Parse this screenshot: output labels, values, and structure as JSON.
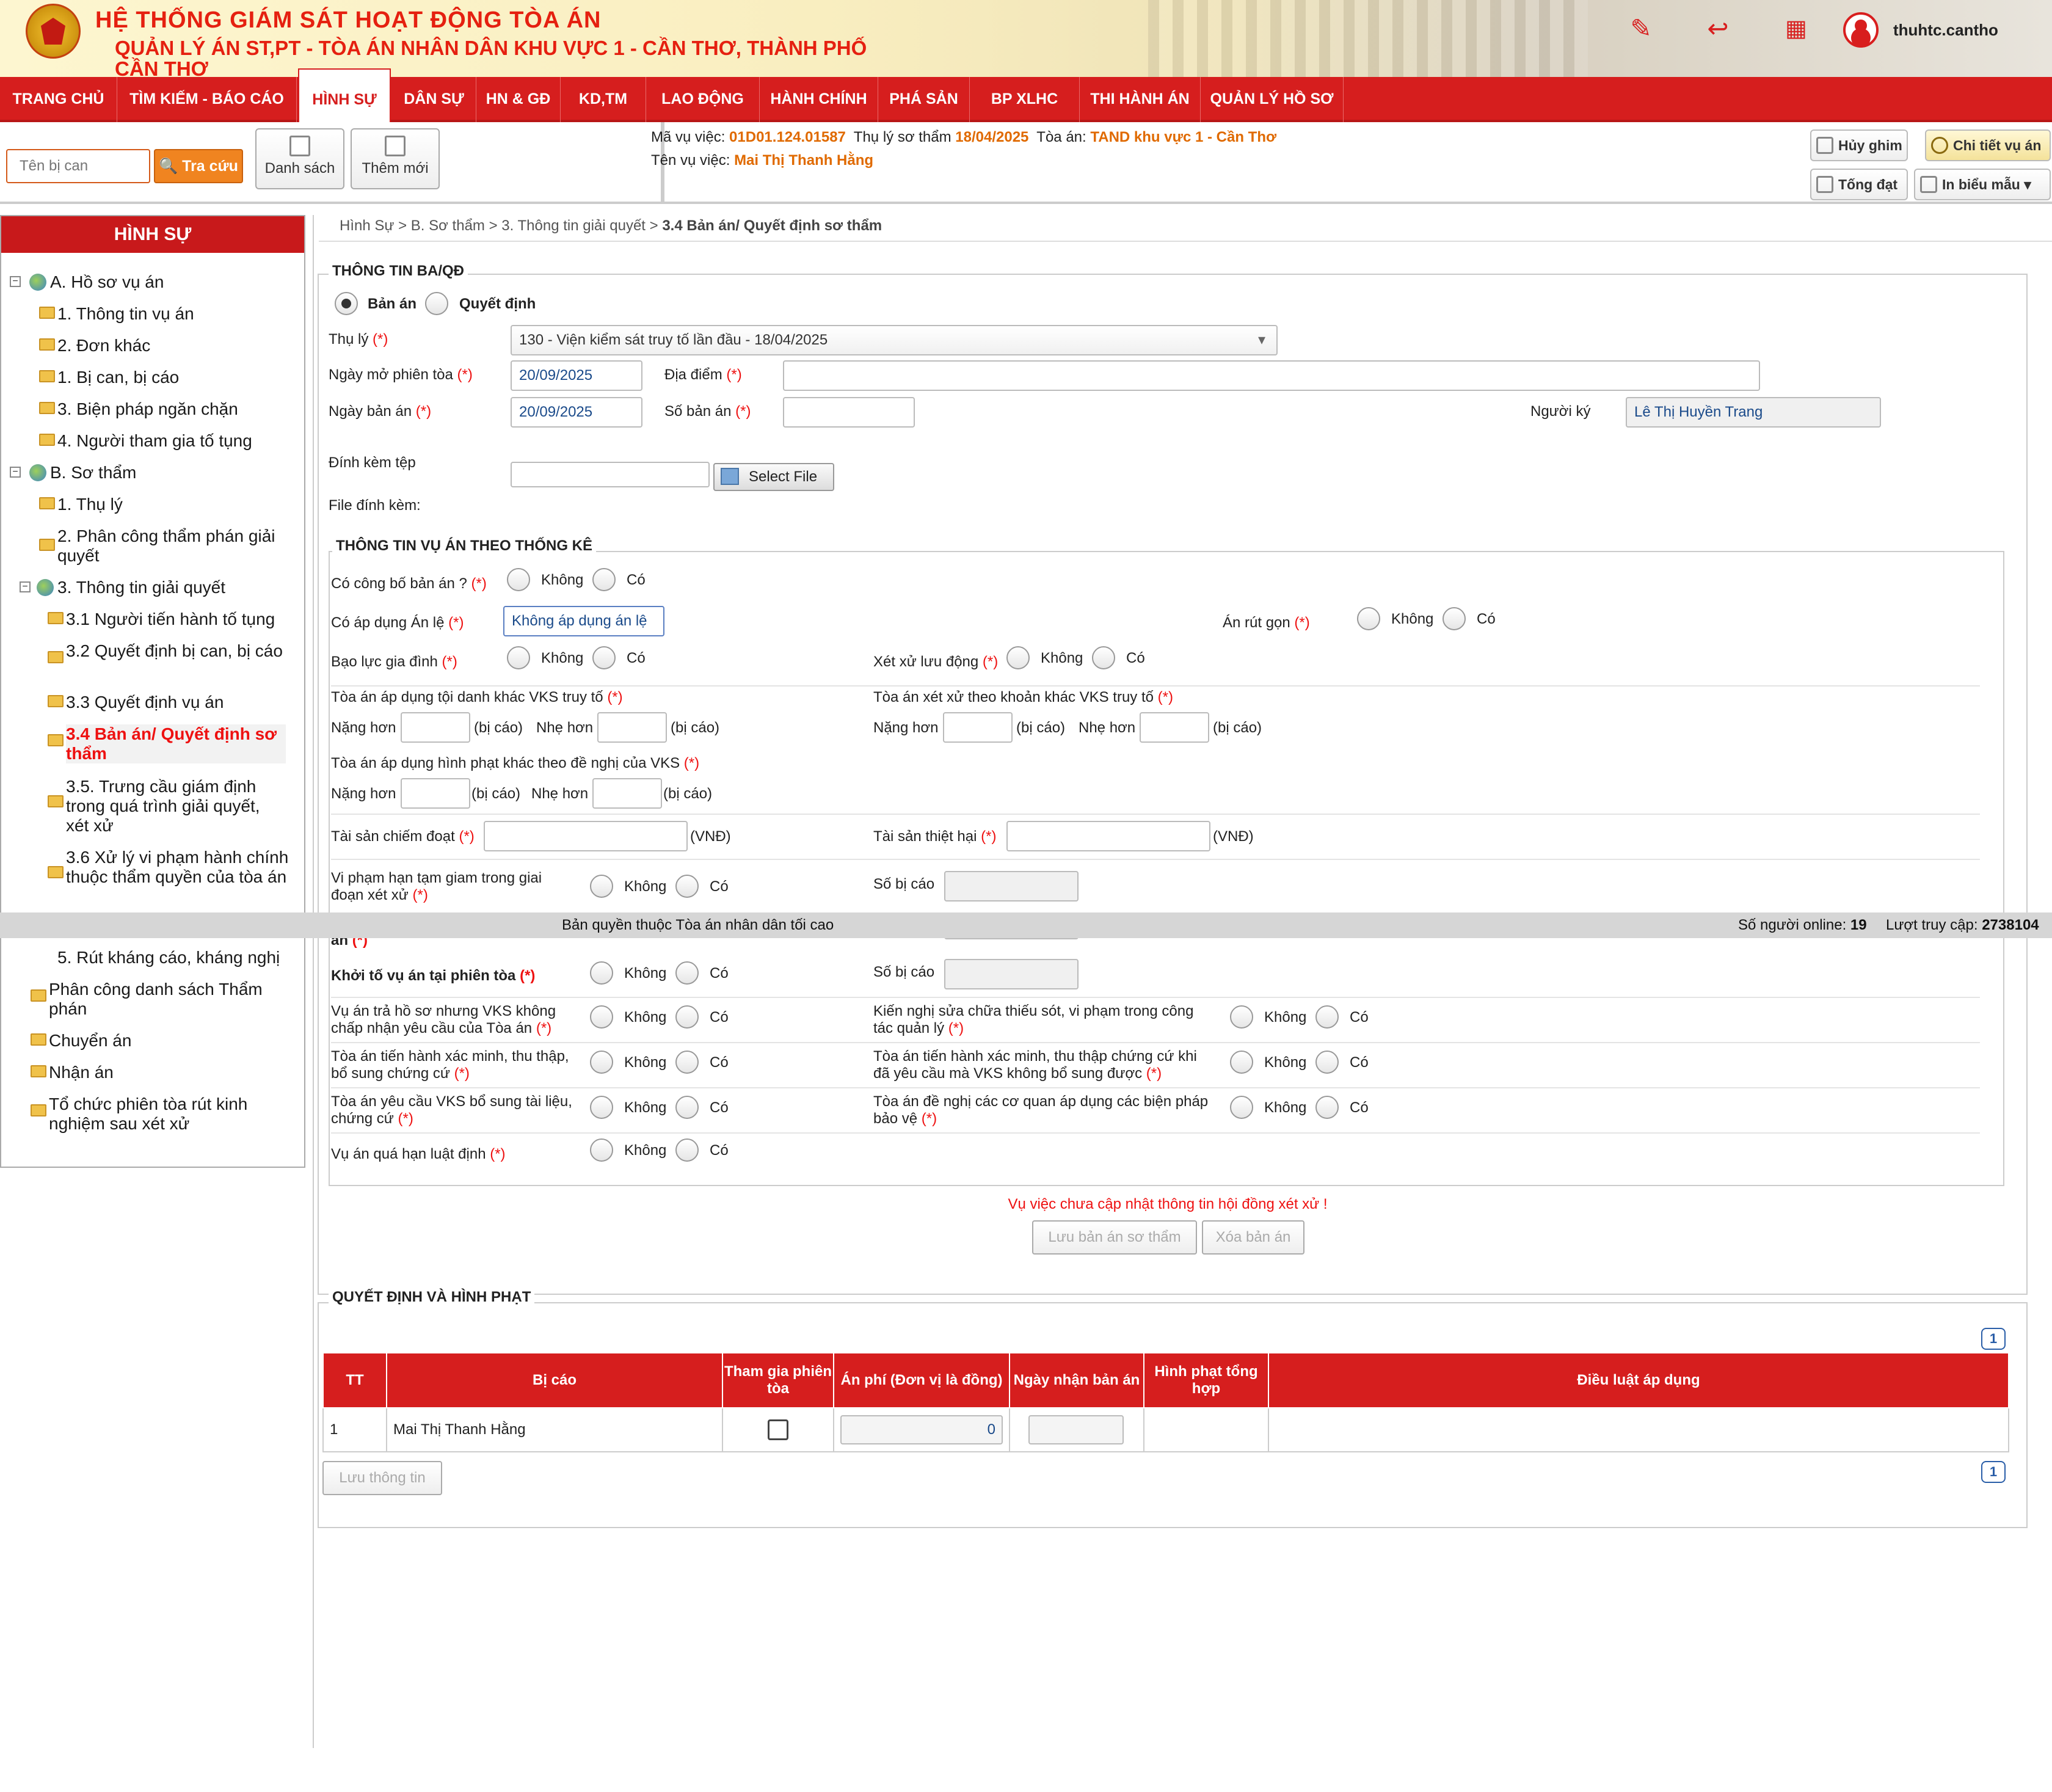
{
  "header": {
    "system_title": "HỆ THỐNG GIÁM SÁT HOẠT ĐỘNG TÒA ÁN",
    "subtitle": "QUẢN LÝ ÁN ST,PT   -   TÒA ÁN NHÂN DÂN KHU VỰC 1 - CẦN THƠ, THÀNH PHỐ CẦN THƠ",
    "username": "thuhtc.cantho"
  },
  "nav": [
    "TRANG CHỦ",
    "TÌM KIẾM - BÁO CÁO",
    "HÌNH SỰ",
    "DÂN SỰ",
    "HN & GĐ",
    "KD,TM",
    "LAO ĐỘNG",
    "HÀNH CHÍNH",
    "PHÁ SẢN",
    "BP XLHC",
    "THI HÀNH ÁN",
    "QUẢN LÝ HỒ SƠ"
  ],
  "toolbar": {
    "search_placeholder": "Tên bị can",
    "search_btn": "Tra cứu",
    "list_btn": "Danh sách",
    "add_btn": "Thêm mới",
    "unpin": "Hủy ghim",
    "detail": "Chi tiết vụ án",
    "deliver": "Tống đạt",
    "print": "In biểu mẫu"
  },
  "case": {
    "code_label": "Mã vụ việc:",
    "code": "01D01.124.01587",
    "accept_label": "Thụ lý sơ thẩm",
    "accept_date": "18/04/2025",
    "court_label": "Tòa án:",
    "court": "TAND khu vực 1 - Cần Thơ",
    "name_label": "Tên vụ việc:",
    "name": "Mai Thị Thanh Hằng"
  },
  "sidebar": {
    "title": "HÌNH SỰ",
    "items": [
      "A. Hồ sơ vụ án",
      "1. Thông tin vụ án",
      "2. Đơn khác",
      "1. Bị can, bị cáo",
      "3. Biện pháp ngăn chặn",
      "4. Người tham gia tố tụng",
      "B. Sơ thẩm",
      "1. Thụ lý",
      "2. Phân công thẩm phán giải quyết",
      "3. Thông tin giải quyết",
      "3.1 Người tiến hành tố tụng",
      "3.2 Quyết định bị can, bị cáo",
      "3.3 Quyết định vụ án",
      "3.4 Bản án/ Quyết định sơ thẩm",
      "3.5. Trưng cầu giám định trong quá trình giải quyết, xét xử",
      "3.6 Xử lý vi phạm hành chính thuộc thẩm quyền của tòa án",
      "5. Rút kháng cáo, kháng nghị",
      "Phân công danh sách Thẩm phán",
      "Chuyển án",
      "Nhận án",
      "Tổ chức phiên tòa rút kinh nghiệm sau xét xử"
    ]
  },
  "breadcrumb": {
    "path": "Hình Sự > B. Sơ thẩm > 3. Thông tin giải quyết > ",
    "current": "3.4 Bản án/ Quyết định sơ thẩm"
  },
  "form": {
    "sec1": "THÔNG TIN BA/QĐ",
    "opt_ban_an": "Bản án",
    "opt_qd": "Quyết định",
    "thu_ly_label": "Thụ lý",
    "thu_ly_value": "130 - Viện kiểm sát truy tố lần đầu - 18/04/2025",
    "ngay_mo_label": "Ngày mở phiên tòa",
    "ngay_mo": "20/09/2025",
    "dia_diem_label": "Địa điểm",
    "ngay_ban_an_label": "Ngày bản án",
    "ngay_ban_an": "20/09/2025",
    "so_ban_an_label": "Số bản án",
    "nguoi_ky_label": "Người ký",
    "nguoi_ky": "Lê Thị Huyền Trang",
    "dinh_kem_label": "Đính kèm tệp",
    "select_file": "Select File",
    "file_dinh_kem": "File đính kèm:",
    "sec2": "THÔNG TIN VỤ ÁN THEO THỐNG KÊ",
    "khong": "Không",
    "co": "Có",
    "req": "(*)",
    "cong_bo": "Có công bố bản án ?",
    "an_le": "Có áp dụng Án lệ",
    "an_le_value": "Không áp dụng án lệ",
    "an_rut_gon": "Án rút gọn",
    "bao_luc": "Bạo lực gia đình",
    "luu_dong": "Xét xử lưu động",
    "toi_danh_khac": "Tòa án áp dụng tội danh khác VKS truy tố",
    "khoan_khac": "Tòa án xét xử theo khoản khác VKS truy tố",
    "nang_hon": "Nặng hơn",
    "nhe_hon": "Nhẹ hơn",
    "bi_cao": "(bị cáo)",
    "hinh_phat_khac": "Tòa án áp dụng hình phạt khác theo đề nghị của VKS",
    "tai_san_chiem": "Tài sản chiếm đoạt",
    "tai_san_thiet_hai": "Tài sản thiệt hại",
    "vnd": "(VNĐ)",
    "vi_pham_tam_giam": "Vi phạm hạn tạm giam trong giai đoạn xét xử",
    "so_bi_cao": "Số bị cáo",
    "an_cut": "án",
    "khoi_to": "Khởi tố vụ án tại phiên tòa",
    "tra_ho_so": "Vụ án trả hồ sơ nhưng VKS không chấp nhận yêu cầu của Tòa án",
    "kien_nghi_sua": "Kiến nghị sửa chữa thiếu sót, vi phạm trong công tác quản lý",
    "xac_minh": "Tòa án tiến hành xác minh, thu thập, bổ sung chứng cứ",
    "xac_minh2": "Tòa án tiến hành xác minh, thu thập chứng cứ khi đã yêu cầu mà VKS không bổ sung được",
    "yeu_cau_vks": "Tòa án yêu cầu VKS bổ sung tài liệu, chứng cứ",
    "de_nghi_bien_phap": "Tòa án đề nghị các cơ quan áp dụng các biện pháp bảo vệ",
    "qua_han": "Vụ án quá hạn luật định",
    "warning": "Vụ việc chưa cập nhật thông tin hội đồng xét xử !",
    "save_btn": "Lưu bản án sơ thẩm",
    "delete_btn": "Xóa bản án",
    "sec3": "QUYẾT ĐỊNH VÀ HÌNH PHẠT",
    "save_info": "Lưu thông tin",
    "page": "1"
  },
  "table": {
    "headers": [
      "TT",
      "Bị cáo",
      "Tham gia phiên tòa",
      "Án phí (Đơn vị là đồng)",
      "Ngày nhận bản án",
      "Hình phạt tổng hợp",
      "Điều luật áp dụng"
    ],
    "rows": [
      {
        "tt": "1",
        "bi_cao": "Mai Thị Thanh Hằng",
        "an_phi": "0"
      }
    ]
  },
  "footer": {
    "copyright": "Bản quyền thuộc Tòa án nhân dân tối cao",
    "online_label": "Số người online:",
    "online": "19",
    "visits_label": "Lượt truy cập:",
    "visits": "2738104"
  }
}
